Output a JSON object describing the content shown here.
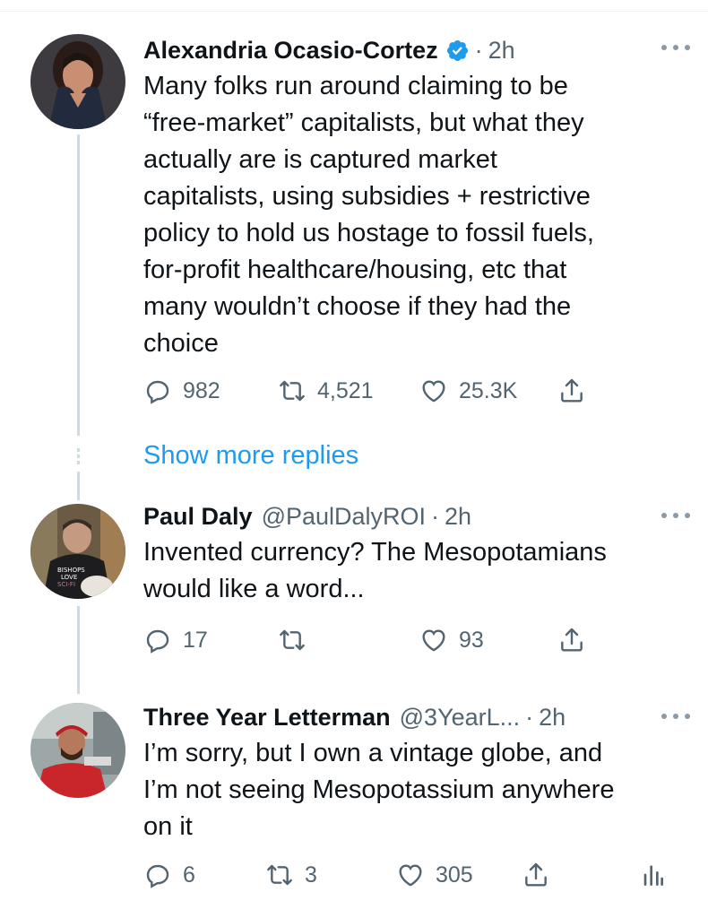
{
  "tweets": [
    {
      "name": "Alexandria Ocasio-Cortez",
      "verified": true,
      "handle": "",
      "time": "2h",
      "text": "Many folks run around claiming to be\n“free-market” capitalists, but what they\nactually are is captured market\ncapitalists, using subsidies + restrictive\npolicy to hold us hostage to fossil fuels,\nfor-profit healthcare/housing, etc that\nmany wouldn’t choose if they had the\nchoice",
      "replies": "982",
      "retweets": "4,521",
      "likes": "25.3K"
    },
    {
      "name": "Paul Daly",
      "verified": false,
      "handle": "@PaulDalyROI",
      "time": "2h",
      "text": "Invented currency? The Mesopotamians\nwould like a word...",
      "replies": "17",
      "retweets": "",
      "likes": "93"
    },
    {
      "name": "Three Year Letterman",
      "verified": false,
      "handle": "@3YearL...",
      "time": "2h",
      "text": "I’m sorry, but I own a vintage globe, and\nI’m not seeing Mesopotassium anywhere\non it",
      "replies": "6",
      "retweets": "3",
      "likes": "305"
    }
  ],
  "show_more_replies": "Show more replies",
  "separator": "·",
  "colors": {
    "accent": "#1d9bf0",
    "secondary_text": "#536471",
    "thread_line": "#cfd9de"
  },
  "icons": {
    "reply": "reply-icon",
    "retweet": "retweet-icon",
    "like": "heart-icon",
    "share": "share-icon",
    "analytics": "analytics-icon",
    "more": "more-icon",
    "verified": "verified-badge-icon"
  }
}
